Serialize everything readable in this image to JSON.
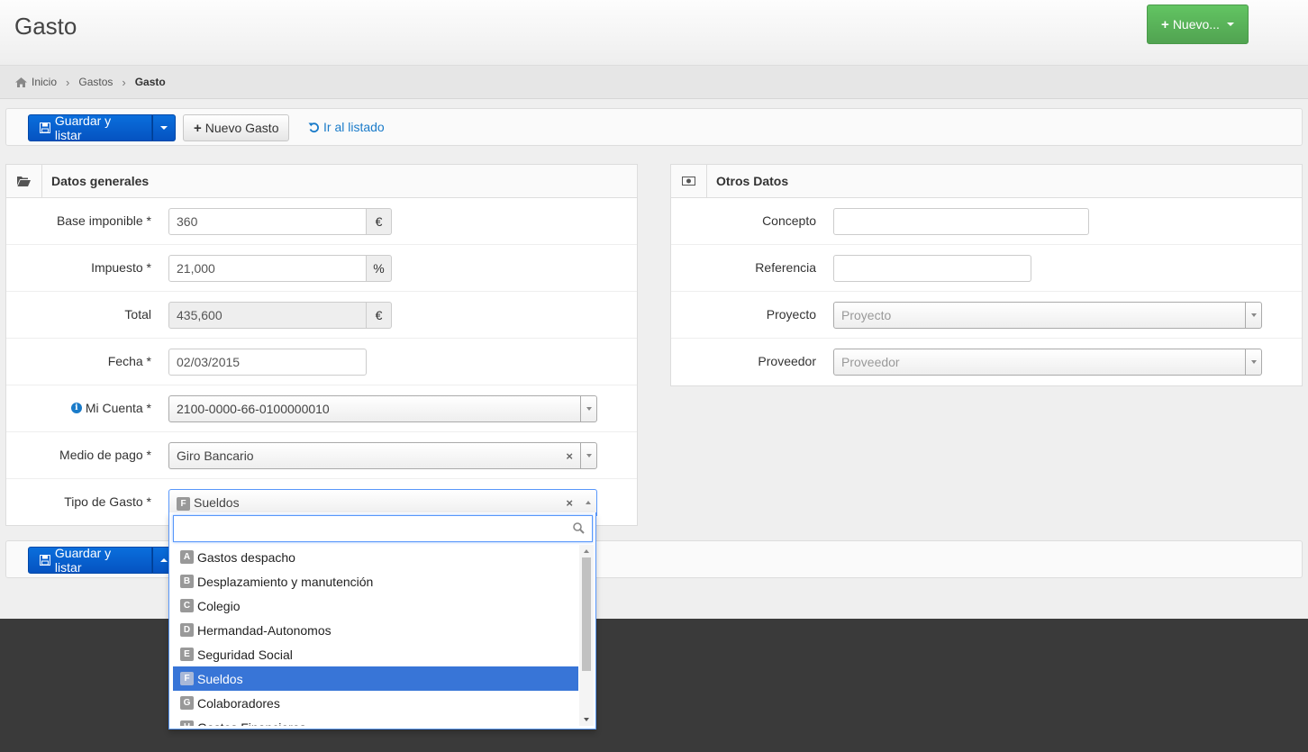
{
  "header": {
    "title": "Gasto",
    "new_button": "Nuevo..."
  },
  "breadcrumb": {
    "home": "Inicio",
    "section": "Gastos",
    "current": "Gasto"
  },
  "toolbar": {
    "save_list": "Guardar y listar",
    "new_gasto": "Nuevo Gasto",
    "go_list": "Ir al listado"
  },
  "general": {
    "title": "Datos generales",
    "base_label": "Base imponible *",
    "base_value": "360",
    "base_unit": "€",
    "tax_label": "Impuesto *",
    "tax_value": "21,000",
    "tax_unit": "%",
    "total_label": "Total",
    "total_value": "435,600",
    "total_unit": "€",
    "date_label": "Fecha *",
    "date_value": "02/03/2015",
    "account_label": "Mi Cuenta *",
    "account_value": "2100-0000-66-0100000010",
    "payment_label": "Medio de pago *",
    "payment_value": "Giro Bancario",
    "type_label": "Tipo de Gasto *",
    "type_badge": "F",
    "type_value": "Sueldos"
  },
  "other": {
    "title": "Otros Datos",
    "concept_label": "Concepto",
    "concept_value": "",
    "ref_label": "Referencia",
    "ref_value": "",
    "project_label": "Proyecto",
    "project_placeholder": "Proyecto",
    "supplier_label": "Proveedor",
    "supplier_placeholder": "Proveedor"
  },
  "dropdown": {
    "search_value": "",
    "items": [
      {
        "badge": "A",
        "label": "Gastos despacho"
      },
      {
        "badge": "B",
        "label": "Desplazamiento y manutención"
      },
      {
        "badge": "C",
        "label": "Colegio"
      },
      {
        "badge": "D",
        "label": "Hermandad-Autonomos"
      },
      {
        "badge": "E",
        "label": "Seguridad Social"
      },
      {
        "badge": "F",
        "label": "Sueldos"
      },
      {
        "badge": "G",
        "label": "Colaboradores"
      },
      {
        "badge": "H",
        "label": "Gastos Financieros"
      }
    ],
    "selected_index": 5
  },
  "colors": {
    "primary": "#0553c1",
    "success": "#51a351",
    "highlight": "#3875d7",
    "link": "#1a7bc9"
  }
}
